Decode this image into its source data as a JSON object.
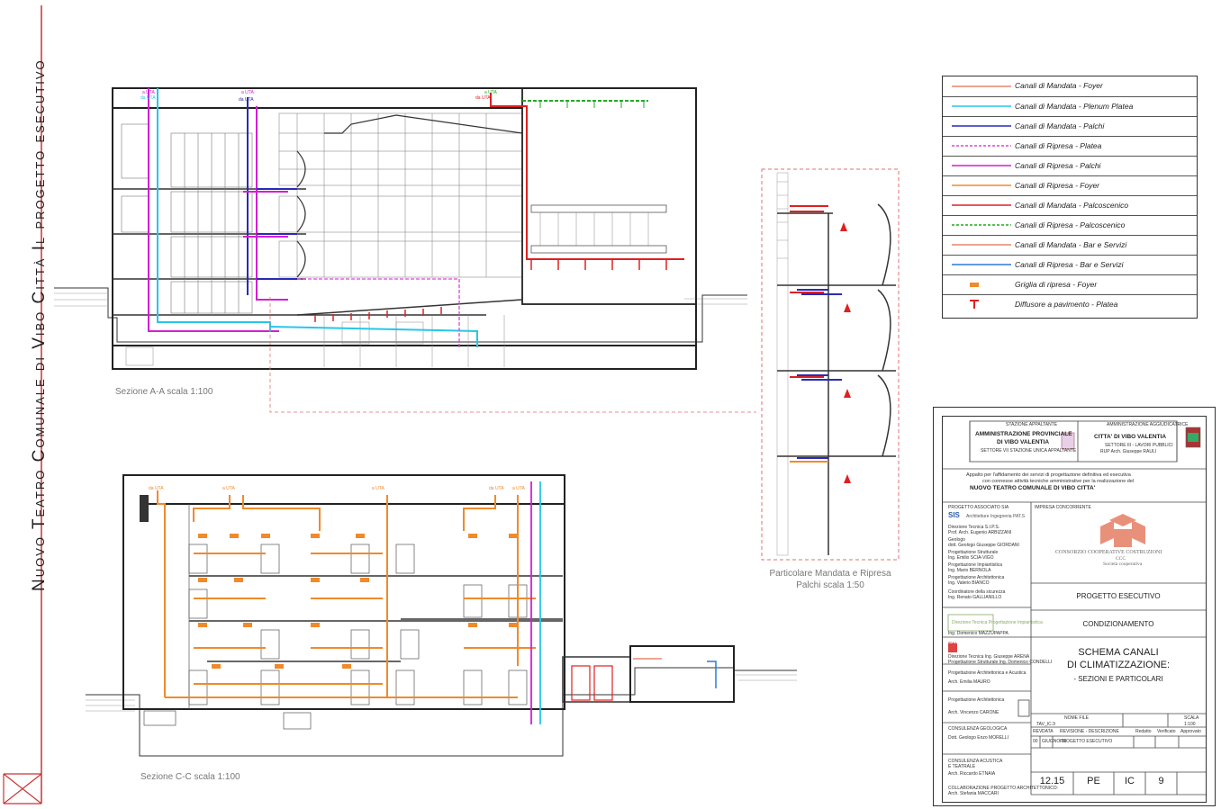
{
  "vertical_title": "Nuovo Teatro Comunale di Vibo Città   Il progetto esecutivo",
  "sections": {
    "aa_caption": "Sezione A-A  scala 1:100",
    "cc_caption": "Sezione C-C  scala 1:100",
    "detail_caption_1": "Particolare Mandata e Ripresa",
    "detail_caption_2": "Palchi scala 1:50"
  },
  "legend": [
    {
      "label": "Canali di Mandata - Foyer",
      "color": "#e8866a",
      "style": "solid"
    },
    {
      "label": "Canali di Mandata - Plenum Platea",
      "color": "#27c7e8",
      "style": "solid"
    },
    {
      "label": "Canali di Mandata - Palchi",
      "color": "#2a2ab8",
      "style": "solid"
    },
    {
      "label": "Canali di Ripresa - Platea",
      "color": "#d946d9",
      "style": "dashed"
    },
    {
      "label": "Canali di Ripresa - Palchi",
      "color": "#d31fd3",
      "style": "solid"
    },
    {
      "label": "Canali di Ripresa - Foyer",
      "color": "#f08a2a",
      "style": "solid"
    },
    {
      "label": "Canali di Mandata - Palcoscenico",
      "color": "#e02020",
      "style": "solid"
    },
    {
      "label": "Canali di Ripresa - Palcoscenico",
      "color": "#22aa22",
      "style": "dashed"
    },
    {
      "label": "Canali di Mandata - Bar e Servizi",
      "color": "#e8866a",
      "style": "solid"
    },
    {
      "label": "Canali di Ripresa - Bar e Servizi",
      "color": "#2a7ad8",
      "style": "solid"
    },
    {
      "label": "Griglia di ripresa - Foyer",
      "color": "#f08a2a",
      "style": "grille"
    },
    {
      "label": "Diffusore a pavimento - Platea",
      "color": "#e02020",
      "style": "diffuser"
    }
  ],
  "title_block": {
    "client_small": "STAZIONE APPALTANTE",
    "client_1": "AMMINISTRAZIONE PROVINCIALE",
    "client_2": "DI VIBO VALENTIA",
    "client_3": "SETTORE VII STAZIONE UNICA APPALTANTE",
    "admin_small": "AMMINISTRAZIONE AGGIUDICATRICE",
    "city_1": "CITTA' DI VIBO VALENTIA",
    "city_2": "SETTORE III - LAVORI PUBBLICI",
    "city_3": "RUP Arch. Giuseppe RAULI",
    "desc_1": "Appalto per l'affidamento dei servizi di progettazione definitiva ed esecutiva",
    "desc_2": "con connesse attività tecniche amministrative per la realizzazione del",
    "project": "NUOVO TEATRO COMUNALE DI VIBO CITTA'",
    "designer_small": "PROGETTO ASSOCIATO SIA",
    "sis": "SIS",
    "sis_sub": "Architetture Ingegneria PAT.S",
    "director": "Direzione Tecnica   S.I.P.S.",
    "director_name": "Prof. Arch. Eugenio ARBIZZANI",
    "geology": "Geologo",
    "geology_name": "dott. Geologo  Giuseppe GIORDANI",
    "structural": "Progettazione Strutturale",
    "structural_name": "Ing. Emilio SCIA-VIGO",
    "plant": "Progettazione Impiantistica",
    "plant_name": "Ing. Mario BERNOLA",
    "architectural": "Progettazione Architettonica",
    "architectural_name": "Ing. Valerio BIANCO",
    "coord": "Coordinatore della sicurezza",
    "coord_name": "Ing. Renato GALLIANILLO",
    "tech_dir": "Direzione Tecnica   Progettazione Impiantistica",
    "tech_dir_name": "Ing. Domenico MAZZUPAPPA",
    "en": "EN",
    "en_dir": "Direzione Tecnica  Ing. Giuseppe ARENA",
    "en_struct": "Progettazione Strutturale  Ing. Domenico CONDELLI",
    "acoustic": "Progettazione Architettonica e Acustica",
    "acoustic_name": "Arch. Emilia MAURO",
    "arch2": "Progettazione Architettonica",
    "arch2_name": "Arch. Vincenzo CARONE",
    "geo2": "CONSULENZA GEOLOGICA",
    "geo2_name": "Dott. Geologo Enzo MORELLI",
    "acoust2": "CONSULENZA ACUSTICA",
    "acoust2_sub": "E TEATRALE",
    "acoust2_name": "Arch. Riccardo ETNAIA",
    "collab": "COLLABORAZIONE PROGETTO ARCHITETTONICO:",
    "collab_name": "Arch. Stefania MACCARI",
    "contractor_small": "IMPRESA CONCORRENTE",
    "contractor_1": "CONSORZIO COOPERATIVE COSTRUZIONI",
    "contractor_2": "CCC",
    "contractor_3": "Società cooperativa",
    "phase": "PROGETTO ESECUTIVO",
    "subject": "CONDIZIONAMENTO",
    "drawing_1": "SCHEMA  CANALI",
    "drawing_2": "DI CLIMATIZZAZIONE:",
    "drawing_3": "- SEZIONI E PARTICOLARI",
    "file_hdr": "NOME FILE",
    "file_val": "TAV_IC.9",
    "scale_hdr": "SCALA",
    "scale_val": "1:100",
    "rev_hdr_1": "REV",
    "rev_hdr_2": "DATA",
    "rev_hdr_3": "REVISIONE - DESCRIZIONE",
    "rev_hdr_4": "Redatto",
    "rev_hdr_5": "Verificato",
    "rev_hdr_6": "Approvato",
    "rev_row_1": "00",
    "rev_row_2": "GIUGNO 15",
    "rev_row_3": "PROGETTO ESECUTIVO",
    "code_1": "12.15",
    "code_2": "PE",
    "code_3": "IC",
    "code_4": "9"
  },
  "labels": {
    "a_uta": "a UTA",
    "da_uta": "da UTA"
  }
}
